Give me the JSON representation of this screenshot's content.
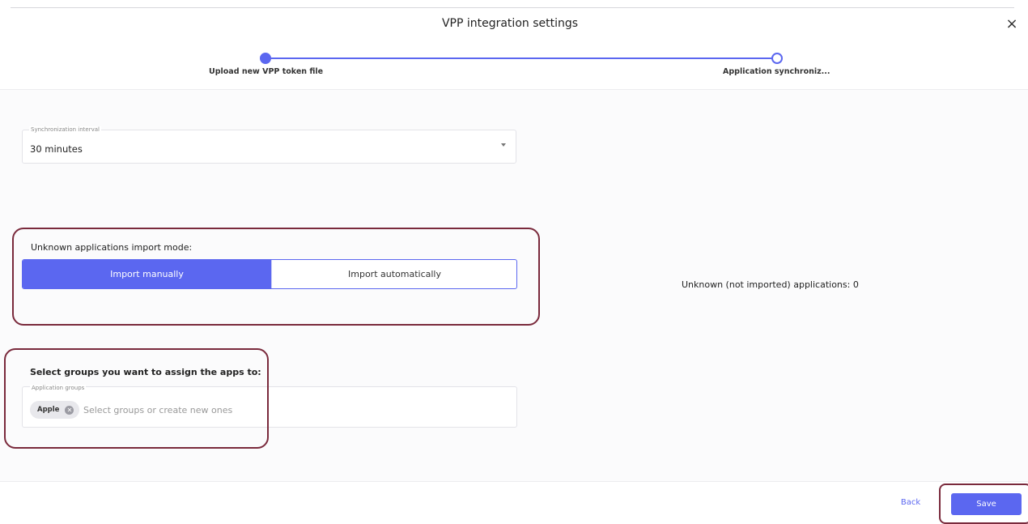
{
  "dialog": {
    "title": "VPP integration settings",
    "close_icon": "×"
  },
  "stepper": {
    "steps": [
      {
        "label": "Upload new VPP token file",
        "state": "completed"
      },
      {
        "label": "Application synchroniz...",
        "state": "current"
      }
    ]
  },
  "sync_interval": {
    "label": "Synchronization interval",
    "value": "30 minutes"
  },
  "import_mode": {
    "label": "Unknown applications import mode:",
    "options": [
      "Import manually",
      "Import automatically"
    ],
    "selected": "Import manually"
  },
  "unknown_apps": {
    "text": "Unknown (not imported) applications: 0"
  },
  "groups": {
    "heading": "Select groups you want to assign the apps to:",
    "field_label": "Application groups",
    "chips": [
      "Apple"
    ],
    "placeholder": "Select groups or create new ones"
  },
  "footer": {
    "back_label": "Back",
    "save_label": "Save"
  },
  "colors": {
    "accent": "#5b67f0",
    "annotation": "#7a2a3c"
  }
}
